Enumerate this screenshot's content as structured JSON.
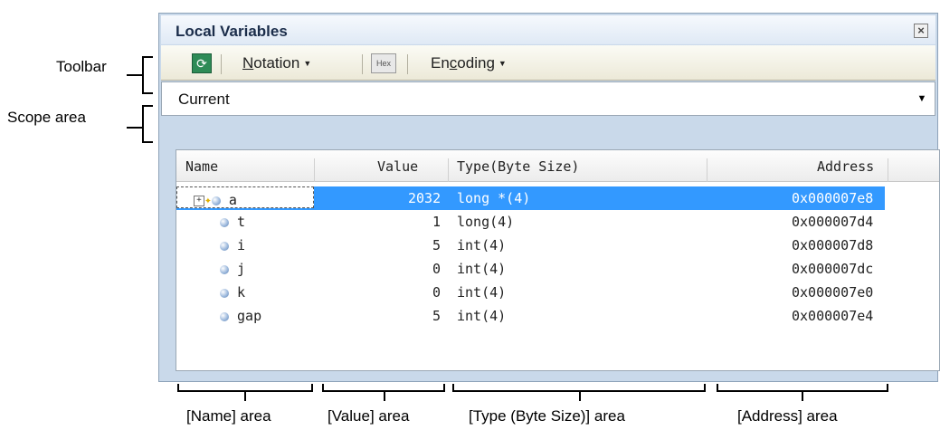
{
  "annotations": {
    "toolbar": "Toolbar",
    "scope": "Scope area",
    "name_area": "[Name] area",
    "value_area": "[Value] area",
    "type_area": "[Type (Byte Size)] area",
    "address_area": "[Address] area"
  },
  "window": {
    "title": "Local Variables",
    "close_icon": "close-icon"
  },
  "toolbar": {
    "refresh_icon": "refresh-icon",
    "notation_label": "Notation",
    "notation_mnemonic": "N",
    "notation_rest": "otation",
    "hex_label": "Hex",
    "encoding_pre": "En",
    "encoding_mnemonic": "c",
    "encoding_post": "oding"
  },
  "scope": {
    "value": "Current"
  },
  "table": {
    "headers": {
      "name": "Name",
      "value": "Value",
      "type": "Type(Byte Size)",
      "address": "Address"
    },
    "rows": [
      {
        "name": "a",
        "value": "2032",
        "type": "long *(4)",
        "address": "0x000007e8",
        "selected": true
      },
      {
        "name": "t",
        "value": "1",
        "type": "long(4)",
        "address": "0x000007d4"
      },
      {
        "name": "i",
        "value": "5",
        "type": "int(4)",
        "address": "0x000007d8"
      },
      {
        "name": "j",
        "value": "0",
        "type": "int(4)",
        "address": "0x000007dc"
      },
      {
        "name": "k",
        "value": "0",
        "type": "int(4)",
        "address": "0x000007e0"
      },
      {
        "name": "gap",
        "value": "5",
        "type": "int(4)",
        "address": "0x000007e4"
      }
    ]
  }
}
